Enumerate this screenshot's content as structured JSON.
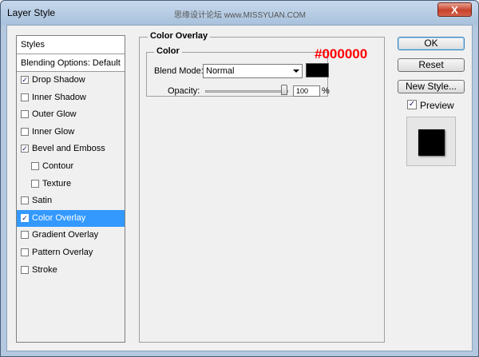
{
  "window": {
    "title": "Layer Style",
    "watermark": "思缘设计论坛 www.MISSYUAN.COM",
    "close_label": "X"
  },
  "styles_panel": {
    "header": "Styles",
    "blending_default": "Blending Options: Default",
    "items": [
      {
        "label": "Drop Shadow",
        "checked": true,
        "sub": false,
        "selected": false
      },
      {
        "label": "Inner Shadow",
        "checked": false,
        "sub": false,
        "selected": false
      },
      {
        "label": "Outer Glow",
        "checked": false,
        "sub": false,
        "selected": false
      },
      {
        "label": "Inner Glow",
        "checked": false,
        "sub": false,
        "selected": false
      },
      {
        "label": "Bevel and Emboss",
        "checked": true,
        "sub": false,
        "selected": false
      },
      {
        "label": "Contour",
        "checked": false,
        "sub": true,
        "selected": false
      },
      {
        "label": "Texture",
        "checked": false,
        "sub": true,
        "selected": false
      },
      {
        "label": "Satin",
        "checked": false,
        "sub": false,
        "selected": false
      },
      {
        "label": "Color Overlay",
        "checked": true,
        "sub": false,
        "selected": true
      },
      {
        "label": "Gradient Overlay",
        "checked": false,
        "sub": false,
        "selected": false
      },
      {
        "label": "Pattern Overlay",
        "checked": false,
        "sub": false,
        "selected": false
      },
      {
        "label": "Stroke",
        "checked": false,
        "sub": false,
        "selected": false
      }
    ]
  },
  "color_overlay": {
    "title": "Color Overlay",
    "group_title": "Color",
    "blend_mode_label": "Blend Mode:",
    "blend_mode_value": "Normal",
    "overlay_color": "#000000",
    "hex_annotation": "#000000",
    "opacity_label": "Opacity:",
    "opacity_value": "100",
    "opacity_unit": "%",
    "opacity_fraction": 1.0
  },
  "buttons": {
    "ok": "OK",
    "reset": "Reset",
    "new_style": "New Style...",
    "preview_label": "Preview",
    "preview_checked": true
  },
  "colors": {
    "selection": "#3399ff",
    "annotation": "#ff0000"
  }
}
